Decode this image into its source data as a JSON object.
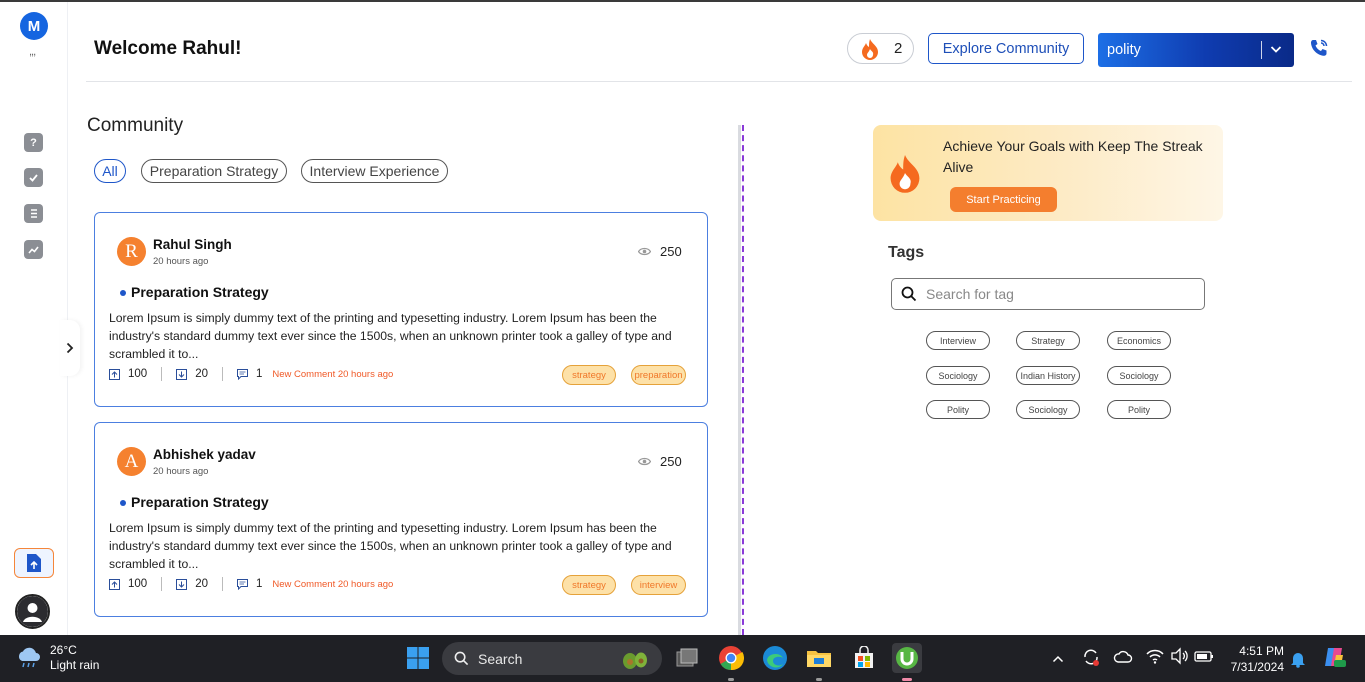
{
  "app": {
    "logo_letter": "M",
    "logo_dots": ",,,"
  },
  "header": {
    "welcome": "Welcome Rahul!",
    "streak_count": "2",
    "explore_label": "Explore Community",
    "exam_selected": "polity"
  },
  "community": {
    "title": "Community",
    "filters": [
      "All",
      "Preparation Strategy",
      "Interview Experience"
    ],
    "active_filter": "All",
    "posts": [
      {
        "initial": "R",
        "author": "Rahul Singh",
        "time": "20 hours ago",
        "views": "250",
        "category": "Preparation Strategy",
        "text": "Lorem Ipsum is simply dummy text of the printing and typesetting industry. Lorem Ipsum has been the industry's standard dummy text ever since the 1500s, when an unknown printer took a galley of type and scrambled it to...",
        "upvotes": "100",
        "downvotes": "20",
        "comments": "1",
        "new_comment": "New Comment 20 hours ago",
        "tags": [
          "strategy",
          "preparation"
        ]
      },
      {
        "initial": "A",
        "author": "Abhishek yadav",
        "time": "20 hours ago",
        "views": "250",
        "category": "Preparation Strategy",
        "text": "Lorem Ipsum is simply dummy text of the printing and typesetting industry. Lorem Ipsum has been the industry's standard dummy text ever since the 1500s, when an unknown printer took a galley of type and scrambled it to...",
        "upvotes": "100",
        "downvotes": "20",
        "comments": "1",
        "new_comment": "New Comment 20 hours ago",
        "tags": [
          "strategy",
          "interview"
        ]
      }
    ]
  },
  "streak_banner": {
    "text": "Achieve Your Goals with Keep The Streak Alive",
    "button": "Start Practicing"
  },
  "tags": {
    "title": "Tags",
    "search_placeholder": "Search for tag",
    "items": [
      "Interview",
      "Strategy",
      "Economics",
      "Sociology",
      "Indian History",
      "Sociology",
      "Polity",
      "Sociology",
      "Polity"
    ]
  },
  "taskbar": {
    "temperature": "26°C",
    "weather": "Light rain",
    "search_label": "Search",
    "time": "4:51 PM",
    "date": "7/31/2024"
  },
  "colors": {
    "primary": "#1e56c9",
    "accent_orange": "#f47e2e",
    "card_border": "#4c7fe0",
    "dashed_divider": "#8a3ad8"
  }
}
